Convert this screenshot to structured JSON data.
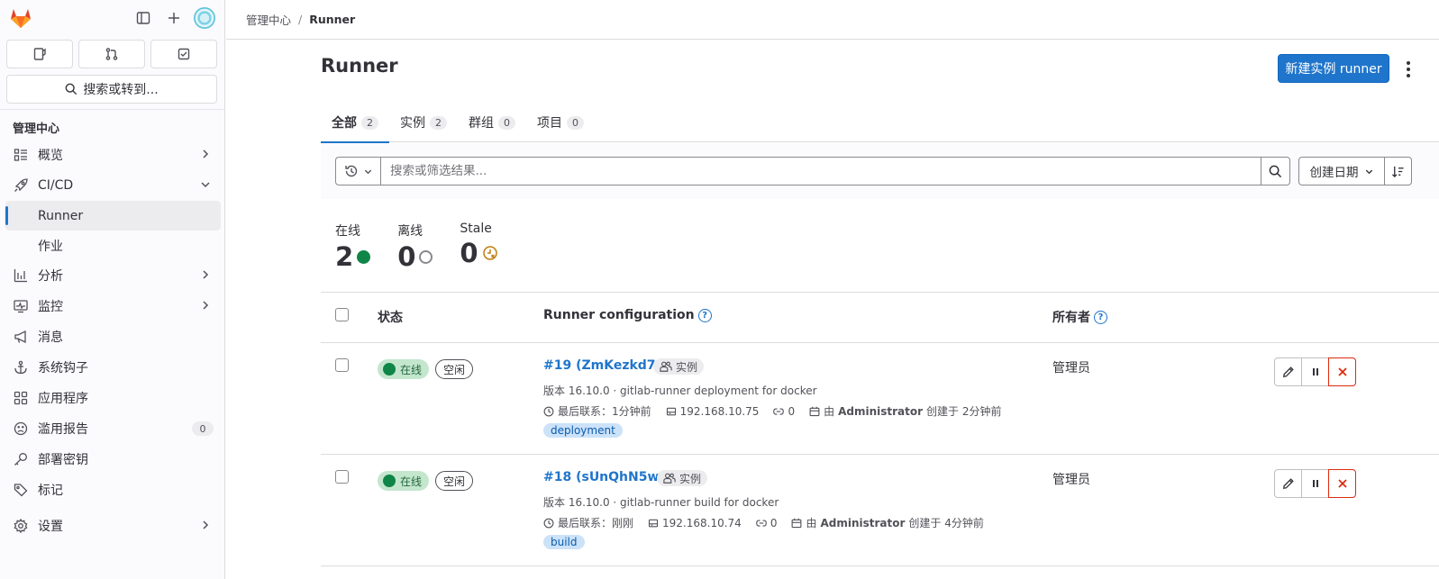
{
  "sidebar": {
    "search_label": "搜索或转到...",
    "section_title": "管理中心",
    "items": [
      {
        "label": "概览"
      },
      {
        "label": "CI/CD"
      },
      {
        "label": "Runner"
      },
      {
        "label": "作业"
      },
      {
        "label": "分析"
      },
      {
        "label": "监控"
      },
      {
        "label": "消息"
      },
      {
        "label": "系统钩子"
      },
      {
        "label": "应用程序"
      },
      {
        "label": "滥用报告",
        "count": "0"
      },
      {
        "label": "部署密钥"
      },
      {
        "label": "标记"
      },
      {
        "label": "设置"
      }
    ]
  },
  "breadcrumb": {
    "parent": "管理中心",
    "separator": "/",
    "current": "Runner"
  },
  "page": {
    "title": "Runner",
    "new_button": "新建实例 runner"
  },
  "tabs": [
    {
      "label": "全部",
      "count": "2"
    },
    {
      "label": "实例",
      "count": "2"
    },
    {
      "label": "群组",
      "count": "0"
    },
    {
      "label": "项目",
      "count": "0"
    }
  ],
  "filter": {
    "placeholder": "搜索或筛选结果...",
    "sort_label": "创建日期"
  },
  "stats": [
    {
      "label": "在线",
      "value": "2"
    },
    {
      "label": "离线",
      "value": "0"
    },
    {
      "label": "Stale",
      "value": "0"
    }
  ],
  "table": {
    "headers": {
      "status": "状态",
      "config": "Runner configuration",
      "owner": "所有者"
    },
    "rows": [
      {
        "status": "在线",
        "idle": "空闲",
        "name": "#19 (ZmKezkd7g)",
        "type": "实例",
        "version": "版本 16.10.0 · gitlab-runner deployment for docker",
        "last_contact": "最后联系：1分钟前",
        "ip": "192.168.10.75",
        "jobs": "0",
        "by_prefix": "由",
        "creator": "Administrator",
        "created": "创建于 2分钟前",
        "tag": "deployment",
        "owner": "管理员"
      },
      {
        "status": "在线",
        "idle": "空闲",
        "name": "#18 (sUnQhN5wL)",
        "type": "实例",
        "version": "版本 16.10.0 · gitlab-runner build for docker",
        "last_contact": "最后联系：刚刚",
        "ip": "192.168.10.74",
        "jobs": "0",
        "by_prefix": "由",
        "creator": "Administrator",
        "created": "创建于 4分钟前",
        "tag": "build",
        "owner": "管理员"
      }
    ]
  },
  "colors": {
    "accent": "#1f75cb",
    "online": "#108548",
    "danger": "#dd2b0e",
    "stale": "#c17d10"
  }
}
